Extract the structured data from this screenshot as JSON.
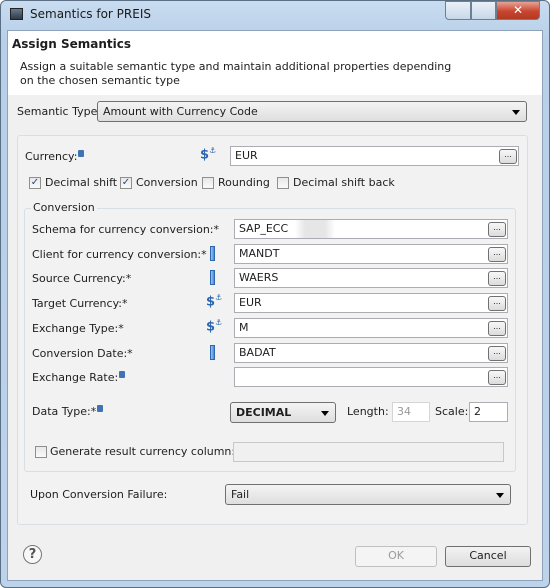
{
  "window": {
    "title": "Semantics for PREIS"
  },
  "header": {
    "title": "Assign Semantics",
    "description": "Assign a suitable semantic type and maintain additional properties depending on the chosen semantic type"
  },
  "semantic_type": {
    "label": "Semantic Type:",
    "value": "Amount with Currency Code"
  },
  "currency": {
    "label": "Currency:",
    "value": "EUR",
    "icon": "currency-constant-icon"
  },
  "options": [
    {
      "label": "Decimal shift",
      "checked": true
    },
    {
      "label": "Conversion",
      "checked": true
    },
    {
      "label": "Rounding",
      "checked": false
    },
    {
      "label": "Decimal shift back",
      "checked": false
    }
  ],
  "conversion": {
    "legend": "Conversion",
    "rows": [
      {
        "label": "Schema for currency conversion:*",
        "value": "SAP_ECC",
        "icon": ""
      },
      {
        "label": "Client for currency conversion:*",
        "value": "MANDT",
        "icon": "column-icon"
      },
      {
        "label": "Source Currency:*",
        "value": "WAERS",
        "icon": "column-icon"
      },
      {
        "label": "Target Currency:*",
        "value": "EUR",
        "icon": "currency-constant-icon"
      },
      {
        "label": "Exchange Type:*",
        "value": "M",
        "icon": "currency-constant-icon"
      },
      {
        "label": "Conversion Date:*",
        "value": "BADAT",
        "icon": "column-icon"
      },
      {
        "label": "Exchange Rate:",
        "value": "",
        "icon": ""
      }
    ],
    "data_type": {
      "label": "Data Type:*",
      "value": "DECIMAL",
      "length_label": "Length:",
      "length": "34",
      "scale_label": "Scale:",
      "scale": "2"
    },
    "generate": {
      "label": "Generate result currency column:",
      "checked": false,
      "value": ""
    }
  },
  "failure": {
    "label": "Upon Conversion Failure:",
    "value": "Fail"
  },
  "footer": {
    "ok": "OK",
    "cancel": "Cancel"
  }
}
